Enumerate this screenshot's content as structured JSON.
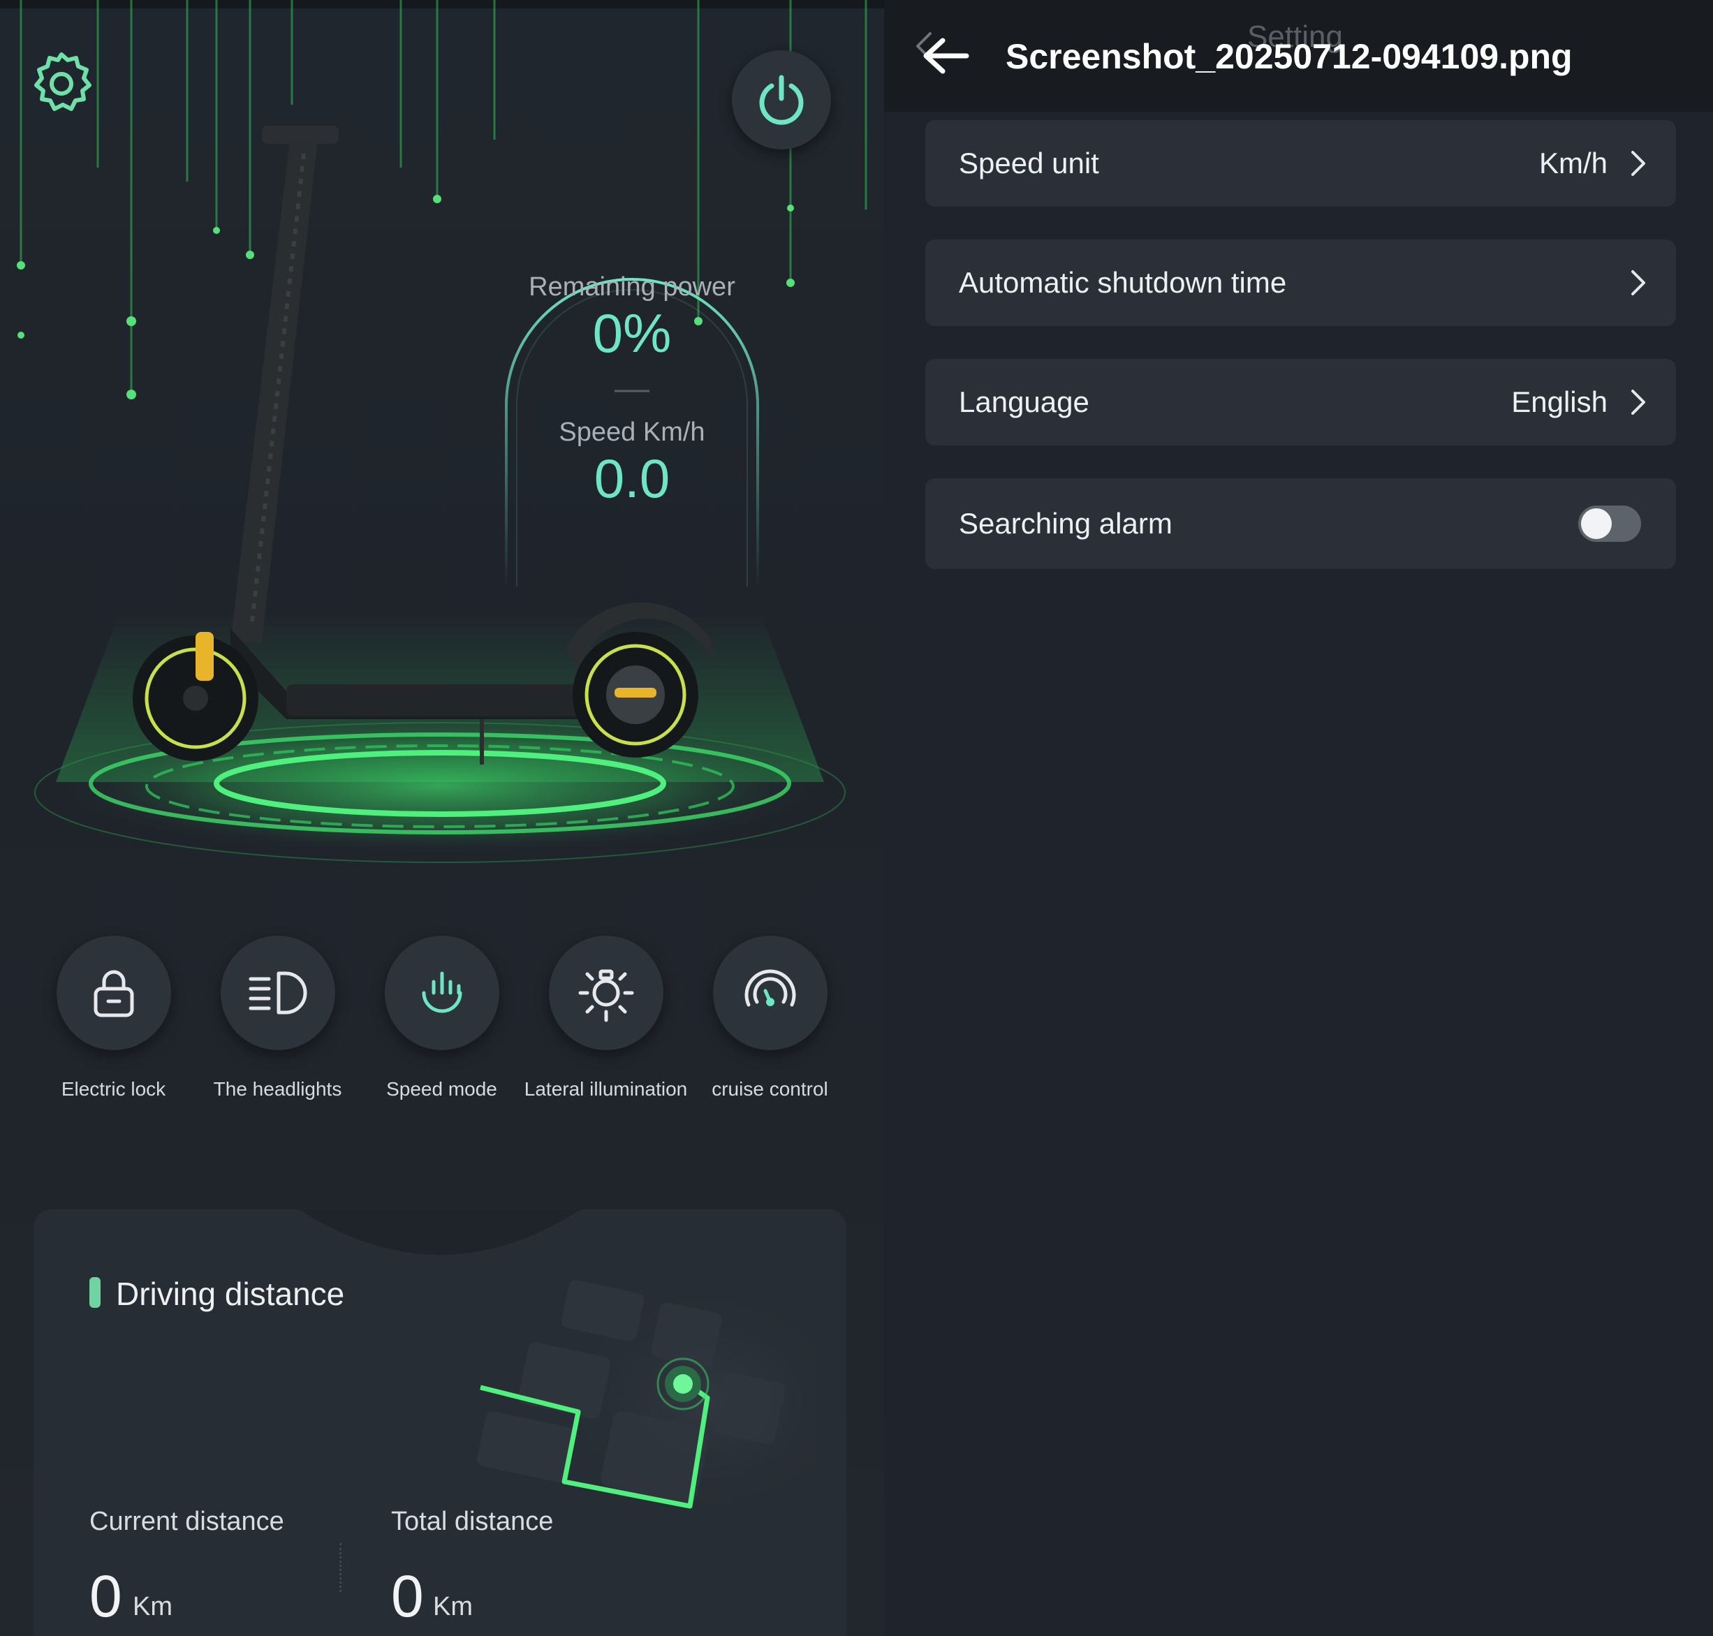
{
  "dashboard": {
    "remaining_power_label": "Remaining power",
    "remaining_power_value": "0%",
    "speed_label": "Speed Km/h",
    "speed_value": "0.0",
    "controls": [
      {
        "label": "Electric lock",
        "icon": "lock-icon"
      },
      {
        "label": "The headlights",
        "icon": "headlight-icon"
      },
      {
        "label": "Speed mode",
        "icon": "speed-mode-icon"
      },
      {
        "label": "Lateral illumination",
        "icon": "lateral-light-icon"
      },
      {
        "label": "cruise control",
        "icon": "cruise-control-icon"
      }
    ],
    "driving_distance": {
      "title": "Driving distance",
      "current_label": "Current distance",
      "current_value": "0",
      "current_unit": "Km",
      "total_label": "Total distance",
      "total_value": "0",
      "total_unit": "Km"
    },
    "accent_color": "#6ee5c3",
    "glow_color": "#3ddc6a"
  },
  "settings": {
    "ghost_title": "Setting",
    "file_title": "Screenshot_20250712-094109.png",
    "rows": [
      {
        "label": "Speed unit",
        "value": "Km/h",
        "type": "link"
      },
      {
        "label": "Automatic shutdown time",
        "value": "",
        "type": "link"
      },
      {
        "label": "Language",
        "value": "English",
        "type": "link"
      },
      {
        "label": "Searching alarm",
        "type": "toggle",
        "enabled": false
      }
    ]
  }
}
